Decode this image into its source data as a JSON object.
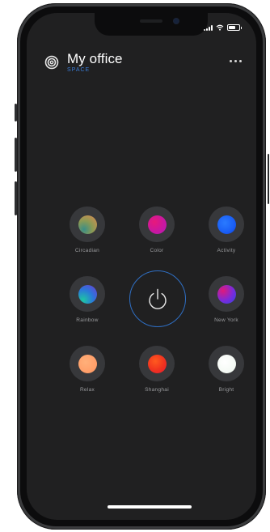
{
  "header": {
    "title": "My office",
    "subtitle": "SPACE"
  },
  "icons": {
    "logo": "concentric-circles-icon",
    "more": "more-dots-icon",
    "power": "power-icon"
  },
  "presets": [
    {
      "label": "Circadian",
      "colors": [
        "#3a8e87",
        "#8a9a55",
        "#e08a4f"
      ]
    },
    {
      "label": "Color",
      "colors": [
        "#e0197a",
        "#b617b8"
      ]
    },
    {
      "label": "Activity",
      "colors": [
        "#1a6dff",
        "#0a3ee0"
      ]
    },
    {
      "label": "Rainbow",
      "colors": [
        "#1dc7a3",
        "#2b78d9",
        "#6d3bd3"
      ]
    },
    {
      "label": "New York",
      "colors": [
        "#e01a7a",
        "#7a2bdc",
        "#2f45e0"
      ]
    },
    {
      "label": "Relax",
      "colors": [
        "#ffb07a",
        "#ff9560"
      ]
    },
    {
      "label": "Shanghai",
      "colors": [
        "#ff5a1f",
        "#e51a35"
      ]
    },
    {
      "label": "Bright",
      "colors": [
        "#ffffff",
        "#eef7ee"
      ]
    }
  ],
  "colors": {
    "background": "#202021",
    "accent": "#3a7bd5",
    "label": "#9a9b9e"
  }
}
